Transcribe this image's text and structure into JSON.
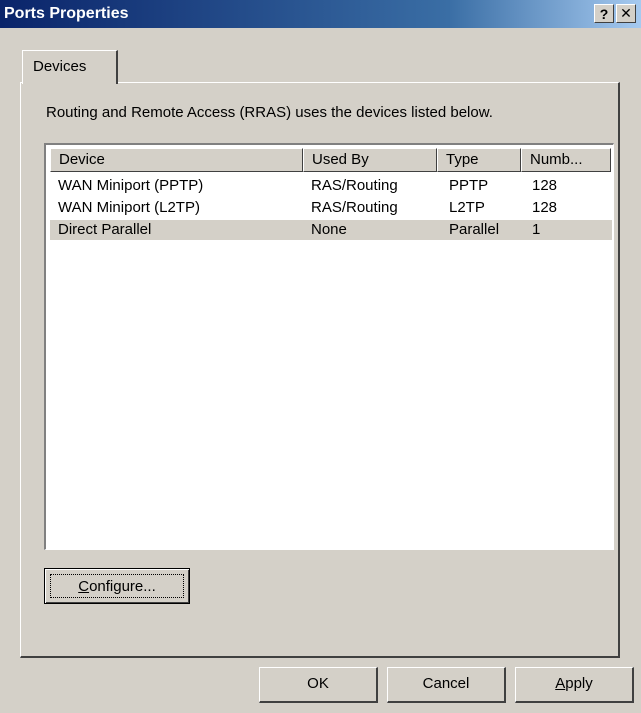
{
  "window": {
    "title": "Ports Properties",
    "help_glyph": "?",
    "close_glyph": "✕"
  },
  "tabs": [
    {
      "label": "Devices",
      "selected": true
    }
  ],
  "panel": {
    "description": "Routing and Remote Access (RRAS) uses the devices listed below."
  },
  "list": {
    "columns": [
      "Device",
      "Used By",
      "Type",
      "Numb..."
    ],
    "rows": [
      {
        "device": "WAN Miniport (PPTP)",
        "used_by": "RAS/Routing",
        "type": "PPTP",
        "number": "128"
      },
      {
        "device": "WAN Miniport (L2TP)",
        "used_by": "RAS/Routing",
        "type": "L2TP",
        "number": "128"
      },
      {
        "device": "Direct Parallel",
        "used_by": "None",
        "type": "Parallel",
        "number": "1",
        "selected": true
      }
    ]
  },
  "buttons": {
    "configure_first": "C",
    "configure_rest": "onfigure...",
    "ok": "OK",
    "cancel": "Cancel",
    "apply_first": "A",
    "apply_rest": "pply"
  },
  "colors": {
    "title_start": "#0a246a",
    "title_end": "#a6caf0",
    "face": "#d4d0c8"
  }
}
